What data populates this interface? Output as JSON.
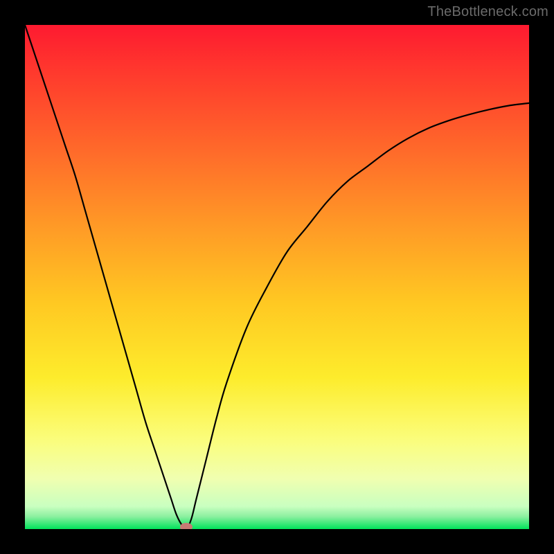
{
  "watermark": {
    "text": "TheBottleneck.com"
  },
  "colors": {
    "frame": "#000000",
    "gradient_top": "#fe1a30",
    "gradient_mid1": "#ff8a2a",
    "gradient_mid2": "#ffd624",
    "gradient_mid3": "#fcfc7a",
    "gradient_mid4": "#e9ffb5",
    "gradient_bottom": "#00e35b",
    "curve": "#000000",
    "marker": "#c77a74"
  },
  "chart_data": {
    "type": "line",
    "title": "",
    "xlabel": "",
    "ylabel": "",
    "xlim": [
      0,
      100
    ],
    "ylim": [
      0,
      100
    ],
    "x": [
      0,
      2,
      4,
      6,
      8,
      10,
      12,
      14,
      16,
      18,
      20,
      22,
      24,
      26,
      28,
      29,
      30,
      31,
      32,
      33,
      34,
      36,
      38,
      40,
      44,
      48,
      52,
      56,
      60,
      64,
      68,
      72,
      76,
      80,
      84,
      88,
      92,
      96,
      100
    ],
    "values": [
      100,
      94,
      88,
      82,
      76,
      70,
      63,
      56,
      49,
      42,
      35,
      28,
      21,
      15,
      9,
      6,
      3,
      1,
      0,
      2,
      6,
      14,
      22,
      29,
      40,
      48,
      55,
      60,
      65,
      69,
      72,
      75,
      77.5,
      79.5,
      81,
      82.2,
      83.2,
      84,
      84.5
    ],
    "marker": {
      "x": 32,
      "y": 0
    },
    "notes": "V-shaped bottleneck curve; minimum near x≈32. Y represents mismatch/bottleneck percentage (red=high, green=low). Axes unlabeled in source image; values estimated from pixel positions."
  }
}
